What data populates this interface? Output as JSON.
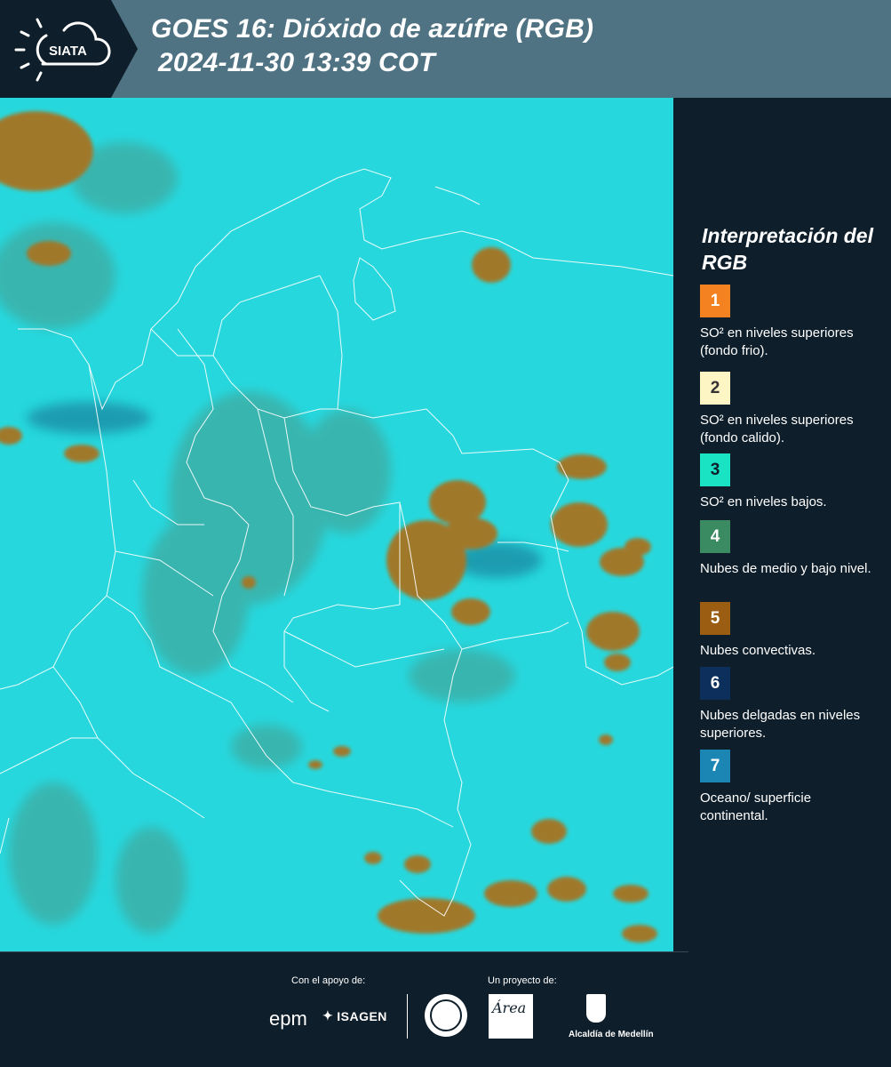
{
  "header": {
    "logo_text": "SIATA",
    "title_line1": "GOES 16: Dióxido de azúfre (RGB)",
    "title_line2": "2024-11-30 13:39 COT"
  },
  "legend": {
    "title": "Interpretación del RGB",
    "items": [
      {
        "number": "1",
        "text": "SO² en niveles superiores (fondo frio).",
        "color": "#f58220",
        "number_color": "#ffffff"
      },
      {
        "number": "2",
        "text": "SO² en niveles superiores (fondo calido).",
        "color": "#fdf5c4",
        "number_color": "#333333"
      },
      {
        "number": "3",
        "text": "SO² en niveles bajos.",
        "color": "#19e3c3",
        "number_color": "#0e1e2a"
      },
      {
        "number": "4",
        "text": "Nubes de medio y bajo nivel.",
        "color": "#3a8a62",
        "number_color": "#ffffff"
      },
      {
        "number": "5",
        "text": "Nubes convectivas.",
        "color": "#9a5d12",
        "number_color": "#ffffff"
      },
      {
        "number": "6",
        "text": "Nubes delgadas en niveles superiores.",
        "color": "#0d2f5c",
        "number_color": "#ffffff"
      },
      {
        "number": "7",
        "text": "Oceano/ superficie continental.",
        "color": "#1b86b3",
        "number_color": "#ffffff"
      }
    ]
  },
  "footer": {
    "support_label": "Con el apoyo de:",
    "project_label": "Un proyecto de:",
    "epm": "epm",
    "isagen": "ISAGEN",
    "area_logo": "Área",
    "alcaldia": "Alcaldía de Medellín"
  },
  "colors": {
    "map_background": "#26d8de",
    "convective_cloud": "#a0782a",
    "low_cloud": "#4a9a8a",
    "border_lines": "#ffffff"
  }
}
